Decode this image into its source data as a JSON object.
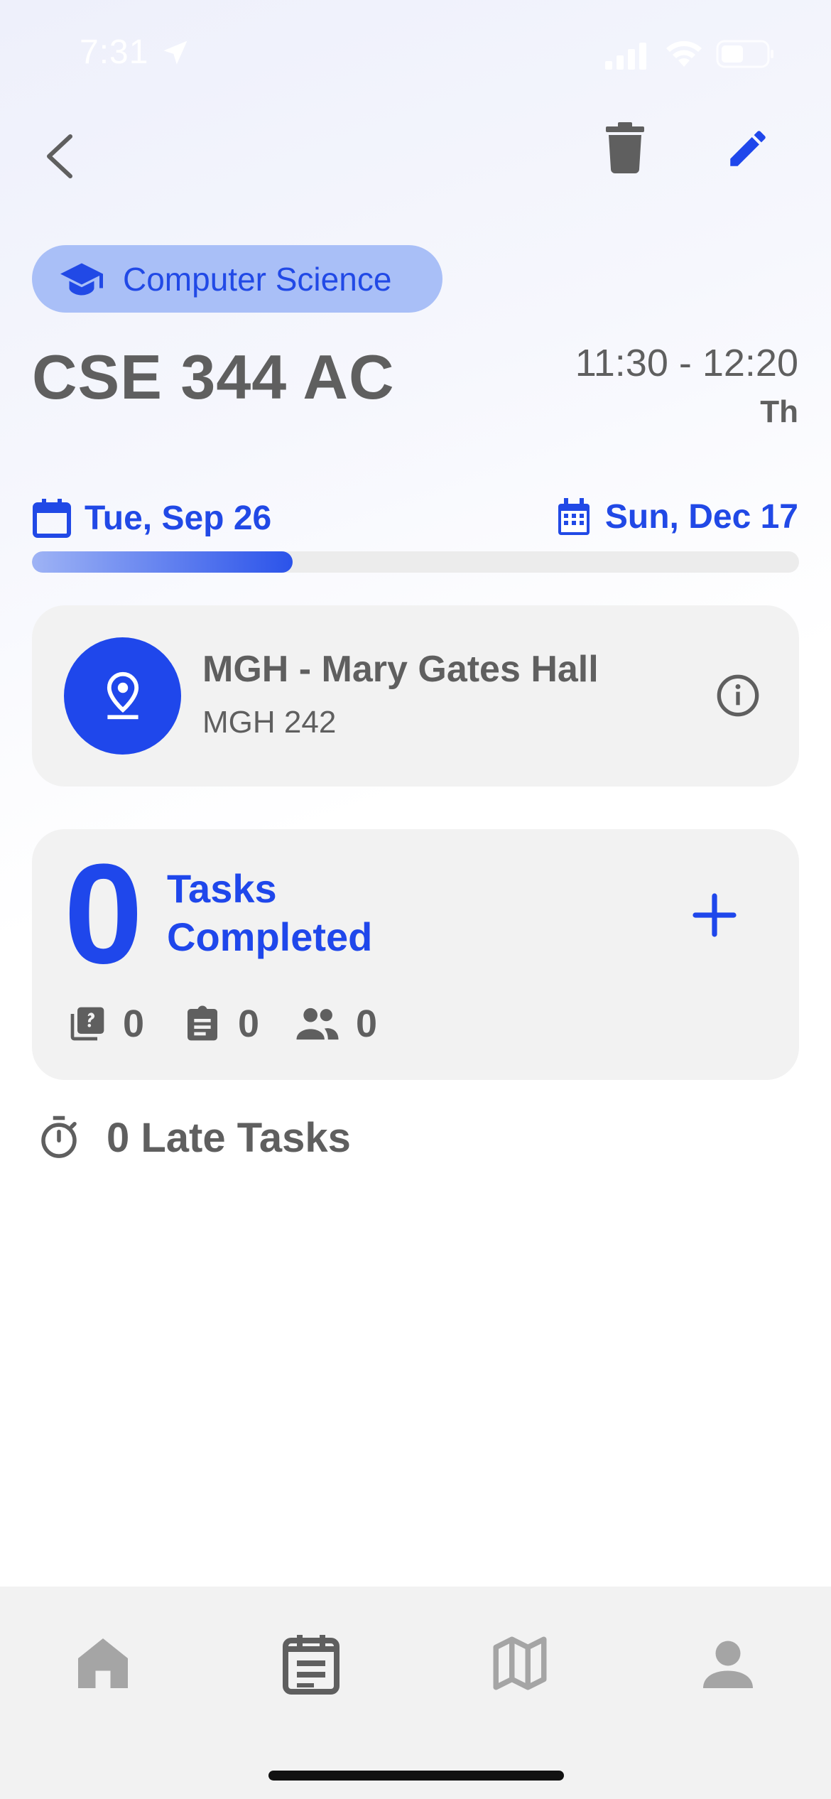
{
  "status_bar": {
    "time": "7:31"
  },
  "header": {
    "back_icon": "chevron-left-icon",
    "delete_icon": "trash-icon",
    "edit_icon": "pencil-icon"
  },
  "course": {
    "category": "Computer Science",
    "title": "CSE 344 AC",
    "time_range": "11:30 - 12:20",
    "days": "Th"
  },
  "term": {
    "start_date": "Tue, Sep 26",
    "end_date": "Sun, Dec 17",
    "progress_fraction": 0.34
  },
  "location": {
    "name": "MGH - Mary Gates Hall",
    "room": "MGH 242"
  },
  "tasks": {
    "completed_count": "0",
    "completed_label_line1": "Tasks",
    "completed_label_line2": "Completed",
    "quiz_count": "0",
    "assignment_count": "0",
    "group_count": "0",
    "late_label": "0 Late Tasks"
  },
  "tabbar": {
    "items": [
      {
        "icon": "home-icon",
        "active": false
      },
      {
        "icon": "calendar-notes-icon",
        "active": true
      },
      {
        "icon": "map-icon",
        "active": false
      },
      {
        "icon": "person-icon",
        "active": false
      }
    ]
  },
  "colors": {
    "accent": "#1f47eb",
    "chip_bg": "#a9bff7",
    "card_bg": "#f2f2f2",
    "text": "#5f5f5f"
  }
}
